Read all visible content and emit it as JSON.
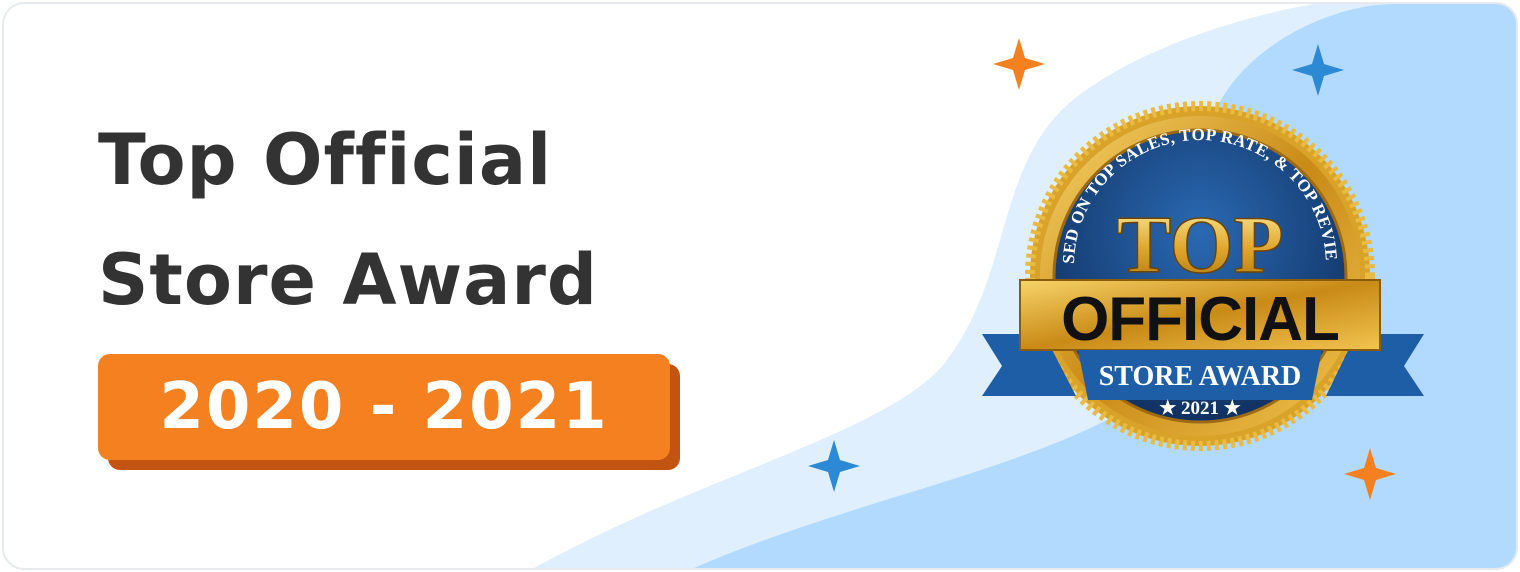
{
  "title": {
    "line1": "Top Official",
    "line2": "Store Award"
  },
  "year_range": "2020 - 2021",
  "badge": {
    "arc_text": "BASED ON TOP SALES, TOP RATE, & TOP REVIEWS",
    "top": "TOP",
    "official": "OFFICIAL",
    "store_award": "STORE AWARD",
    "year": "★ 2021 ★"
  },
  "colors": {
    "title": "#333333",
    "accent_orange": "#f5801f",
    "accent_blue": "#2c89d4",
    "badge_navy": "#17437c",
    "badge_gold": "#d8a128",
    "ribbon_blue": "#1d5ea7"
  },
  "icons": [
    "sparkle-icon",
    "sparkle-icon",
    "sparkle-icon",
    "sparkle-icon"
  ]
}
